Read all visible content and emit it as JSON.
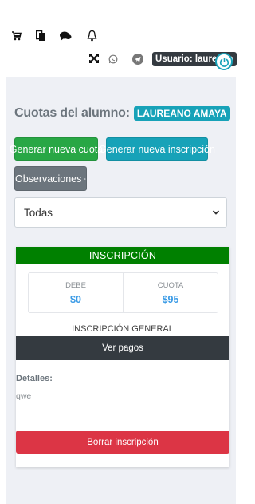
{
  "topbar": {
    "icons": [
      "cart-icon",
      "documents-icon",
      "chat-icon",
      "bell-icon",
      "expand-icon",
      "whatsapp-icon",
      "telegram-icon",
      "power-icon"
    ],
    "user_label": "Usuario: laureano"
  },
  "page": {
    "title": "Cuotas del alumno:",
    "student_name": "LAUREANO AMAYA"
  },
  "actions": {
    "new_fee": "Generar nueva cuota",
    "new_enrollment": "Generar nueva inscripción",
    "observations": "Observaciones"
  },
  "filter": {
    "selected": "Todas"
  },
  "card": {
    "header": "INSCRIPCIÓN",
    "stats": [
      {
        "label": "DEBE",
        "value": "$0"
      },
      {
        "label": "CUOTA",
        "value": "$95"
      }
    ],
    "enrollment_name": "INSCRIPCIÓN GENERAL",
    "view_payments": "Ver pagos",
    "details_label": "Detalles:",
    "details_value": "qwe",
    "delete_label": "Borrar inscripción"
  },
  "colors": {
    "green": "#28a745",
    "teal": "#17a2b8",
    "gray": "#6c757d",
    "dark": "#343a40",
    "red": "#dc3545",
    "card_header": "#008000",
    "stat_value": "#3b9be6"
  }
}
